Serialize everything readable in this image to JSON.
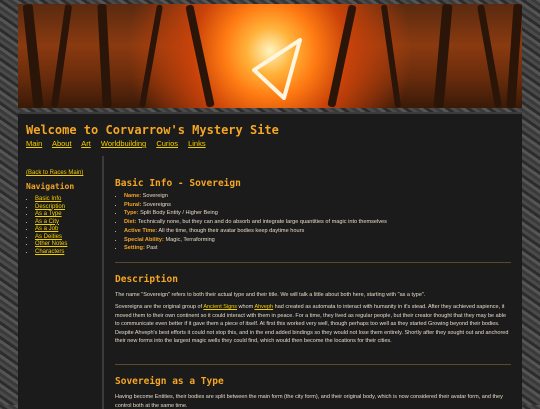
{
  "header": {
    "title": "Welcome to Corvarrow's Mystery Site",
    "nav": [
      "Main",
      "About",
      "Art",
      "Worldbuilding",
      "Curios",
      "Links"
    ]
  },
  "sidebar": {
    "back_link": "(Back to Races Main)",
    "heading": "Navigation",
    "items": [
      "Basic Info",
      "Description",
      "As a Type",
      "As a City",
      "As a Job",
      "As Deities",
      "Other Notes",
      "Characters"
    ]
  },
  "basic_info": {
    "heading": "Basic Info - Sovereign",
    "rows": [
      {
        "label": "Name:",
        "value": " Sovereign"
      },
      {
        "label": "Plural:",
        "value": " Sovereigns"
      },
      {
        "label": "Type:",
        "value": " Split Body Entity / Higher Being"
      },
      {
        "label": "Diet:",
        "value": " Technically none, but they can and do absorb and integrate large quantities of magic into themselves"
      },
      {
        "label": "Active Time:",
        "value": " All the time, though their avatar bodies keep daytime hours"
      },
      {
        "label": "Special Ability:",
        "value": " Magic, Terraforming"
      },
      {
        "label": "Setting:",
        "value": " Past"
      }
    ]
  },
  "description": {
    "heading": "Description",
    "p1": "The name \"Sovereign\" refers to both their actual type and their title. We will talk a little about both here, starting with \"as a type\".",
    "p2_a": "Sovereigns are the original group of ",
    "p2_link1": "Ancient Signs",
    "p2_b": " whom ",
    "p2_link2": "Ahveph",
    "p2_c": " had created as automata to interact with humanity in it's stead. After they achieved sapience, it moved them to their own continent so it could interact with them in peace. For a time, they lived as regular people, but their creator thought that they may be able to communicate even better if it gave them a piece of itself. At first this worked very well, though perhaps too well as they started Growing beyond their bodies. Despite Ahveph's best efforts it could not stop this, and in the end added bindings so they would not lose them entirely. Shortly after they sought out and anchored their new forms into the largest magic wells they could find, which would then become the locations for their cities."
  },
  "as_type": {
    "heading": "Sovereign as a Type",
    "p1": "Having become Entities, their bodies are split between the main form (the city form), and their original body, which is now considered their avatar form, and they control both at the same time."
  }
}
